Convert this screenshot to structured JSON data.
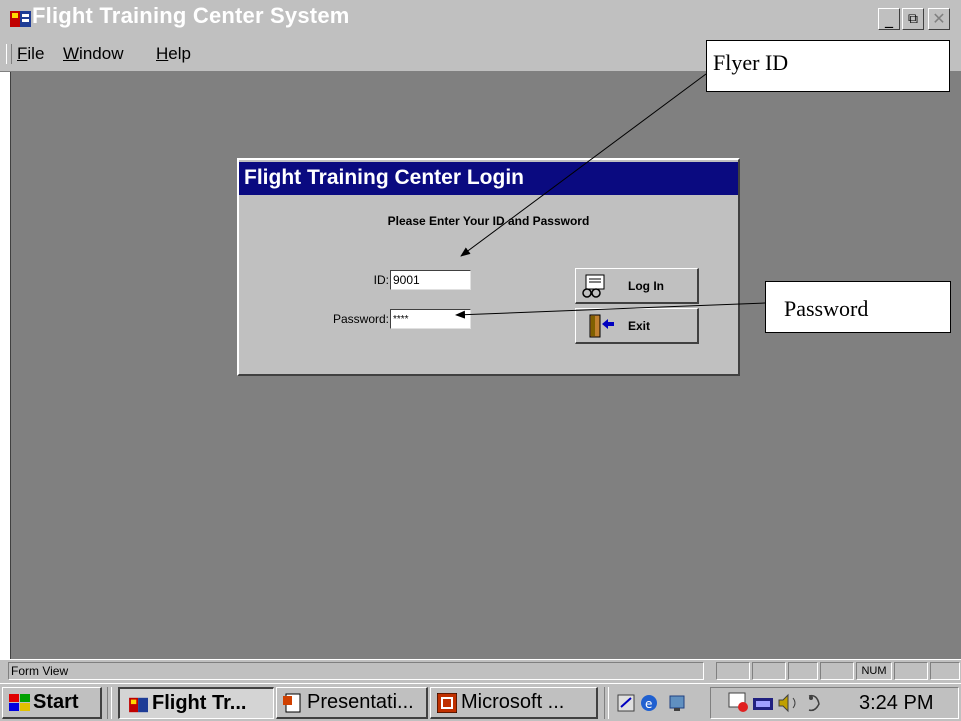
{
  "window": {
    "title": "Flight Training Center System",
    "controls": {
      "minimize": "_",
      "restore": "⧉",
      "close": "✕"
    }
  },
  "menu": {
    "items": [
      {
        "label": "File",
        "accel": "F",
        "rest": "ile"
      },
      {
        "label": "Window",
        "accel": "W",
        "rest": "indow"
      },
      {
        "label": "Help",
        "accel": "H",
        "rest": "elp"
      }
    ]
  },
  "dialog": {
    "title": "Flight Training Center Login",
    "prompt": "Please Enter Your ID and Password",
    "id_label": "ID:",
    "id_value": "9001",
    "password_label": "Password:",
    "password_value": "****",
    "login_label": "Log In",
    "exit_label": "Exit"
  },
  "callouts": {
    "flyer_id": "Flyer ID",
    "password": "Password"
  },
  "statusbar": {
    "text": "Form View",
    "num": "NUM"
  },
  "taskbar": {
    "start": "Start",
    "tasks": [
      {
        "label": "Flight Tr...",
        "active": true
      },
      {
        "label": "Presentati...",
        "active": false
      },
      {
        "label": "Microsoft ...",
        "active": false
      }
    ],
    "clock": "3:24 PM"
  },
  "colors": {
    "dialog_title_bg": "#0a0a80",
    "workspace_bg": "#808080",
    "chrome_bg": "#c0c0c0"
  },
  "icons": [
    "app-icon",
    "login-icon",
    "exit-door-icon",
    "windows-flag-icon",
    "powerpoint-icon",
    "microsoft-icon",
    "tray-icons"
  ]
}
